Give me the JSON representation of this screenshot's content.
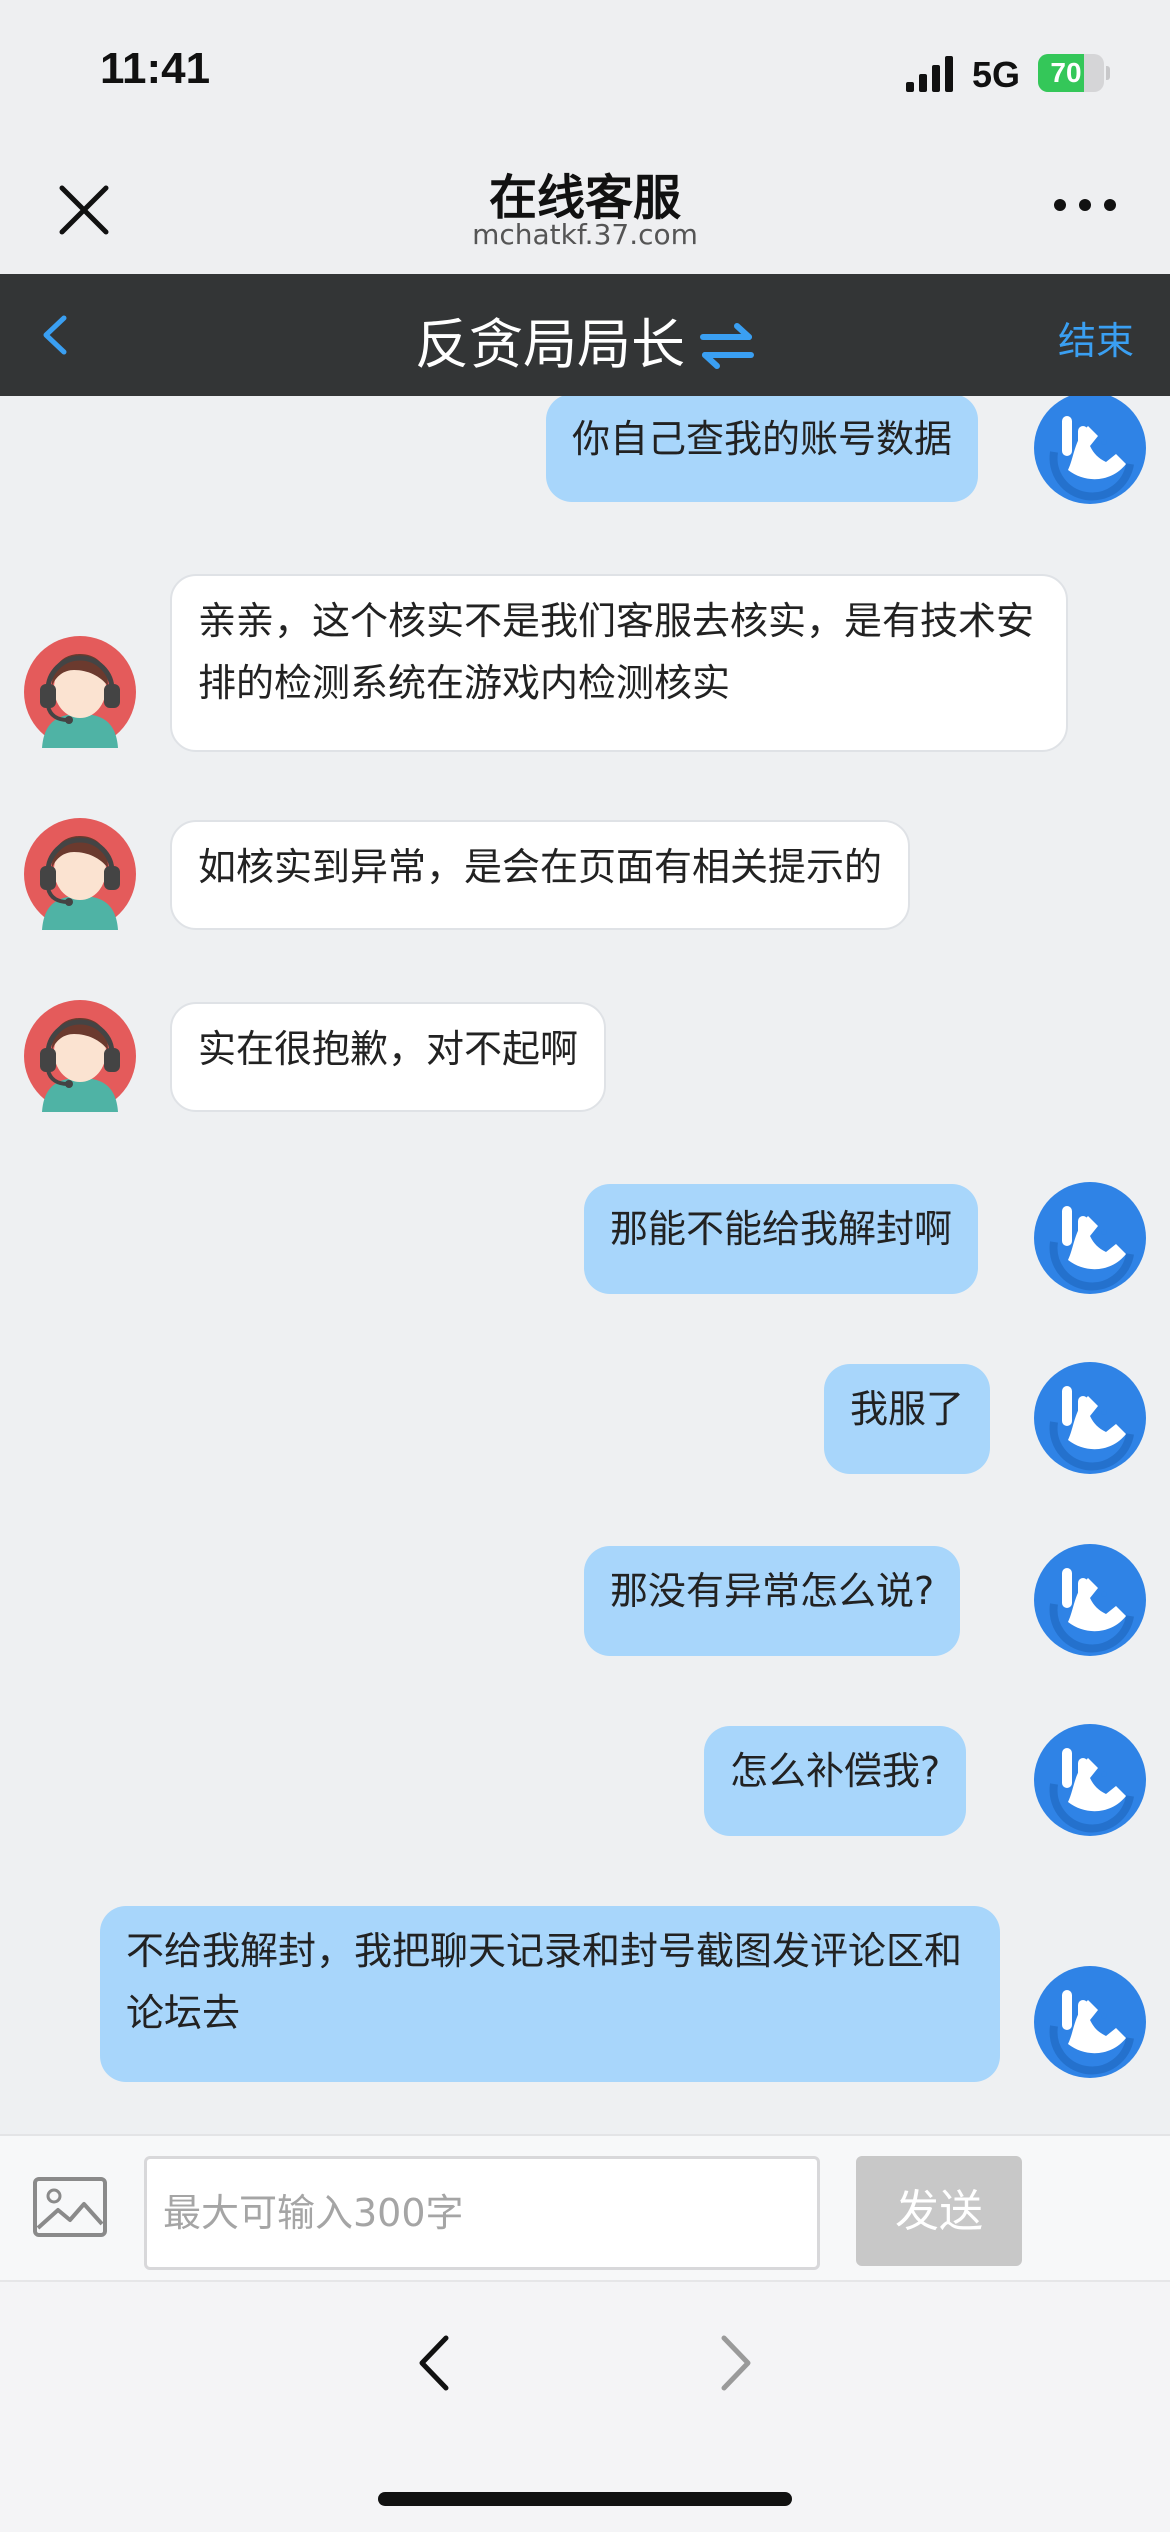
{
  "status_bar": {
    "time": "11:41",
    "network": "5G",
    "battery_percent": "70",
    "battery_level": 0.7,
    "battery_color": "#34c759"
  },
  "browser": {
    "title": "在线客服",
    "url": "mchatkf.37.com",
    "close_icon": "close-icon",
    "more_icon": "more-horizontal-icon"
  },
  "chat_header": {
    "title": "反贪局局长",
    "end_label": "结束",
    "accent_color": "#3a9ff2",
    "swap_icon": "swap-arrows-icon",
    "back_icon": "chevron-left-icon"
  },
  "messages": [
    {
      "sender": "user",
      "text": "你自己查我的账号数据"
    },
    {
      "sender": "agent",
      "text": "亲亲，这个核实不是我们客服去核实，是有技术安排的检测系统在游戏内检测核实"
    },
    {
      "sender": "agent",
      "text": "如核实到异常，是会在页面有相关提示的"
    },
    {
      "sender": "agent",
      "text": "实在很抱歉，对不起啊"
    },
    {
      "sender": "user",
      "text": "那能不能给我解封啊"
    },
    {
      "sender": "user",
      "text": "我服了"
    },
    {
      "sender": "user",
      "text": "那没有异常怎么说?"
    },
    {
      "sender": "user",
      "text": "怎么补偿我?"
    },
    {
      "sender": "user",
      "text": "不给我解封，我把聊天记录和封号截图发评论区和论坛去"
    }
  ],
  "composer": {
    "placeholder": "最大可输入300字",
    "value": "",
    "send_label": "发送",
    "image_icon": "image-upload-icon"
  },
  "bottom_nav": {
    "back_icon": "chevron-left-icon",
    "forward_icon": "chevron-right-icon"
  },
  "colors": {
    "user_bubble": "#a8d6fb",
    "agent_bubble": "#ffffff",
    "header_bg": "#333536"
  }
}
